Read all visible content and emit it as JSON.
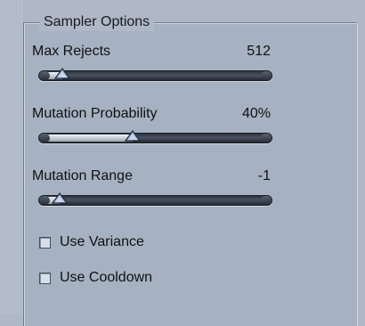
{
  "group": {
    "title": "Sampler Options"
  },
  "sliders": [
    {
      "label": "Max Rejects",
      "value_text": "512",
      "fraction": 0.07
    },
    {
      "label": "Mutation Probability",
      "value_text": "40%",
      "fraction": 0.4
    },
    {
      "label": "Mutation Range",
      "value_text": "-1",
      "fraction": 0.06
    }
  ],
  "checkboxes": [
    {
      "label": "Use Variance",
      "checked": false
    },
    {
      "label": "Use Cooldown",
      "checked": false
    }
  ]
}
